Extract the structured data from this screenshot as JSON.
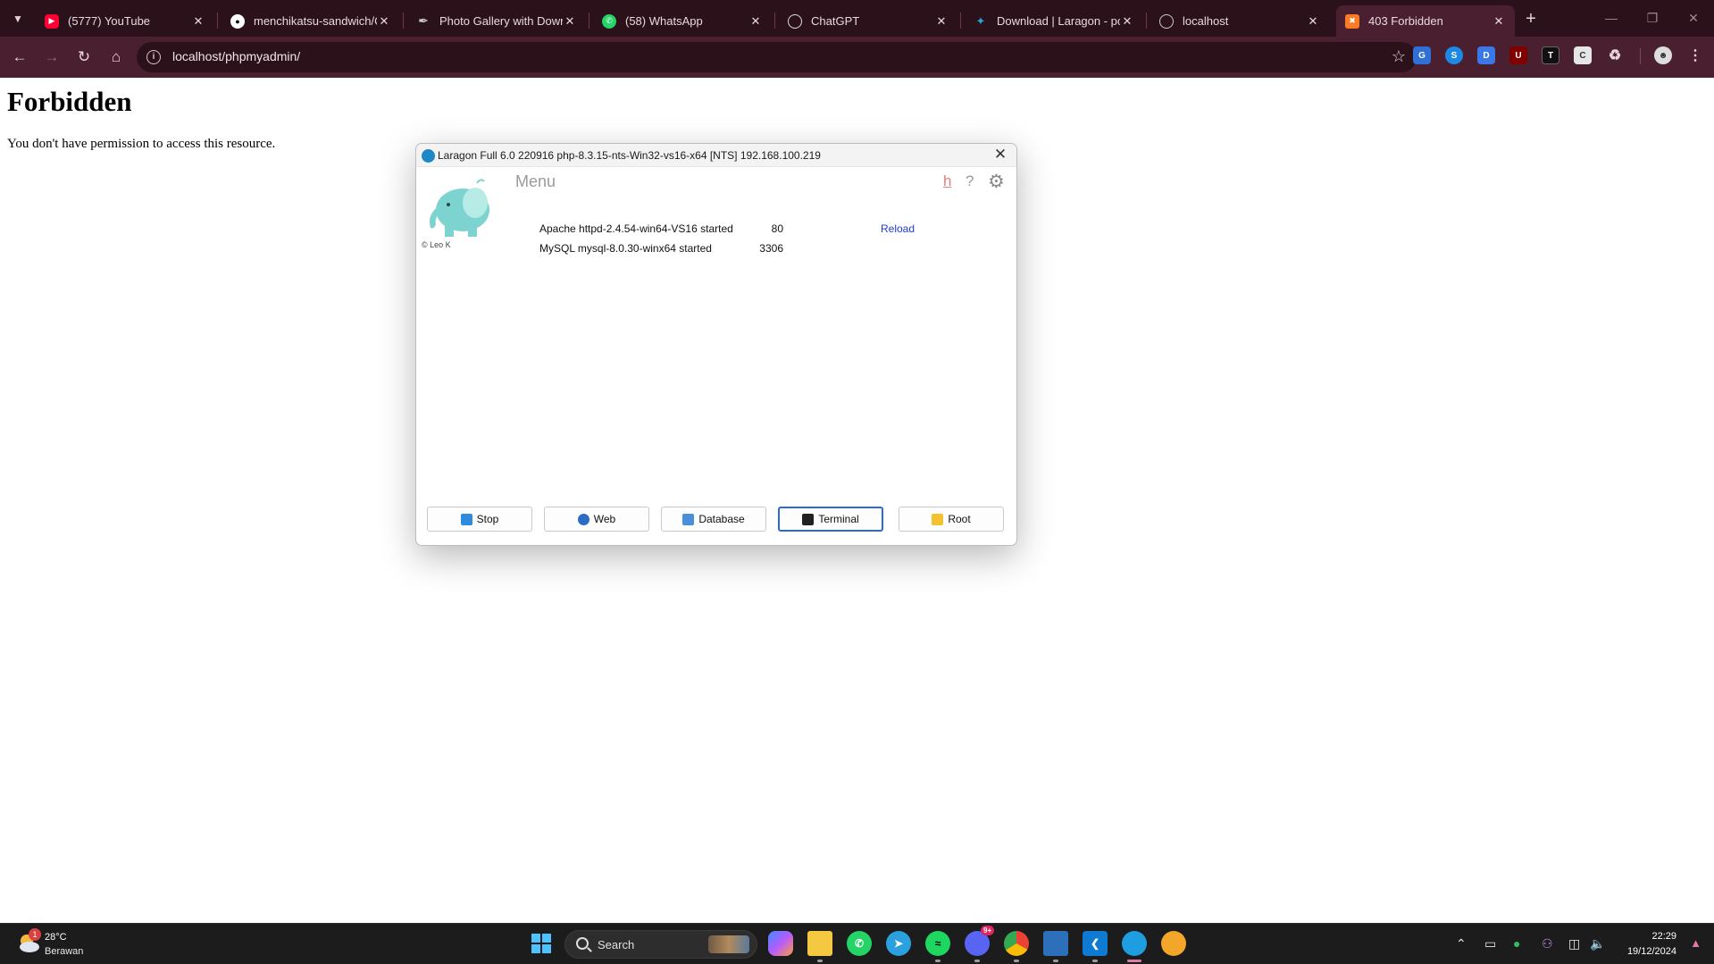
{
  "browser": {
    "tabs": [
      {
        "title": "(5777) YouTube",
        "icon": "youtube-icon",
        "color": "#ff0033"
      },
      {
        "title": "menchikatsu-sandwich/C",
        "icon": "github-icon",
        "color": "#ffffff"
      },
      {
        "title": "Photo Gallery with Downl",
        "icon": "feather-icon",
        "color": "#cccccc"
      },
      {
        "title": "(58) WhatsApp",
        "icon": "whatsapp-icon",
        "color": "#25d366"
      },
      {
        "title": "ChatGPT",
        "icon": "chatgpt-icon",
        "color": "#dddddd"
      },
      {
        "title": "Download | Laragon - por",
        "icon": "laragon-icon",
        "color": "#29a3d6"
      },
      {
        "title": "localhost",
        "icon": "globe-icon",
        "color": "#cccccc"
      },
      {
        "title": "403 Forbidden",
        "icon": "xampp-icon",
        "color": "#fb7a24"
      }
    ],
    "address": "localhost/phpmyadmin/"
  },
  "page": {
    "title": "Forbidden",
    "message": "You don't have permission to access this resource."
  },
  "laragon": {
    "title": "Laragon Full 6.0 220916 php-8.3.15-nts-Win32-vs16-x64 [NTS]  192.168.100.219",
    "menu": "Menu",
    "copyright": "© Leo K",
    "help_h": "h",
    "help_q": "?",
    "services": [
      {
        "name": "Apache httpd-2.4.54-win64-VS16 started",
        "port": "80",
        "action": "Reload"
      },
      {
        "name": "MySQL mysql-8.0.30-winx64 started",
        "port": "3306",
        "action": ""
      }
    ],
    "buttons": {
      "stop": "Stop",
      "web": "Web",
      "database": "Database",
      "terminal": "Terminal",
      "root": "Root"
    }
  },
  "taskbar": {
    "weather": {
      "temp": "28°C",
      "desc": "Berawan",
      "badge": "1"
    },
    "search_label": "Search",
    "discord_badge": "9+",
    "time": "22:29",
    "date": "19/12/2024"
  },
  "colors": {
    "chrome_frame": "#2b1119",
    "chrome_toolbar": "#4a2030",
    "taskbar": "#1c1c1c",
    "link_blue": "#1c3ccf"
  }
}
